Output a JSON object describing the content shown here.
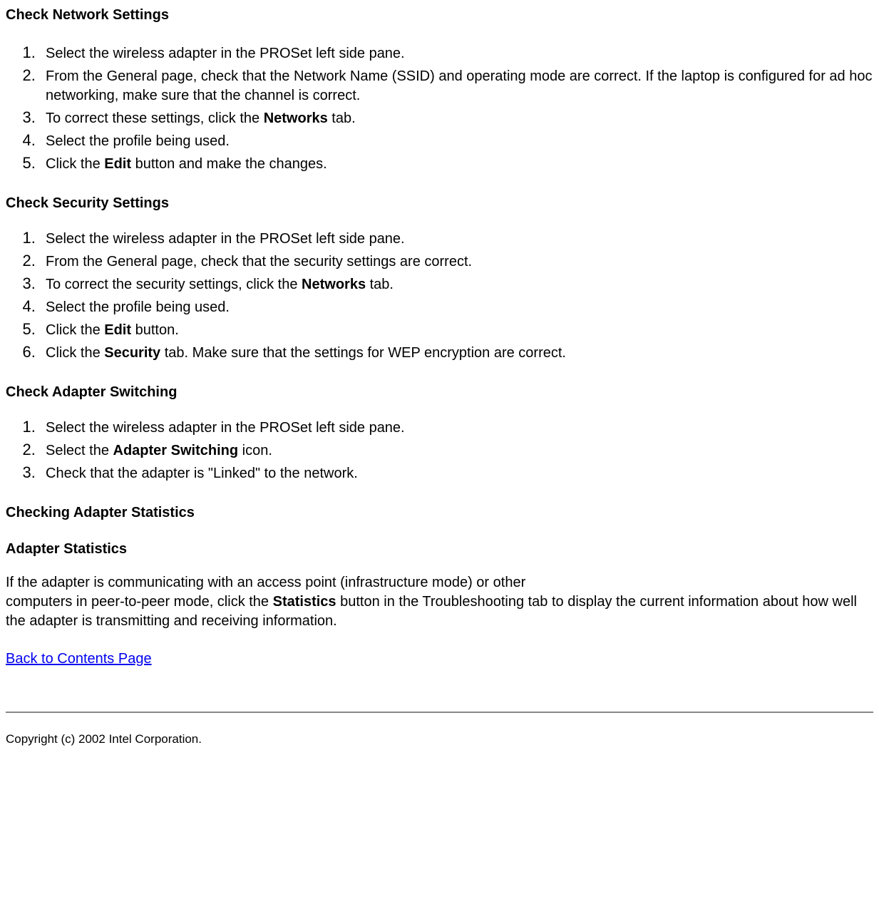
{
  "section1": {
    "heading": "Check Network Settings",
    "items": {
      "i1": "Select the wireless adapter in the PROSet left side pane.",
      "i2": "From the General page, check that the Network Name (SSID) and operating mode are correct. If the laptop is configured for ad hoc networking, make sure that the channel is correct.",
      "i3a": "To correct these settings, click the ",
      "i3b": "Networks",
      "i3c": " tab.",
      "i4": "Select the profile being used.",
      "i5a": "Click the ",
      "i5b": "Edit",
      "i5c": " button and make the changes."
    }
  },
  "section2": {
    "heading": "Check Security Settings",
    "items": {
      "i1": "Select the wireless adapter in the PROSet left side pane.",
      "i2": "From the General page, check that the security settings are correct.",
      "i3a": "To correct the security settings, click the ",
      "i3b": "Networks",
      "i3c": " tab.",
      "i4": "Select the profile being used.",
      "i5a": "Click the ",
      "i5b": "Edit",
      "i5c": " button.",
      "i6a": "Click the ",
      "i6b": "Security",
      "i6c": " tab. Make sure that the settings for WEP encryption are correct."
    }
  },
  "section3": {
    "heading": "Check Adapter Switching",
    "items": {
      "i1": "Select the wireless adapter in the PROSet left side pane.",
      "i2a": "Select the ",
      "i2b": "Adapter Switching",
      "i2c": " icon.",
      "i3": "Check that the adapter is \"Linked\" to the network."
    }
  },
  "section4": {
    "heading": "Checking Adapter Statistics",
    "subheading": "Adapter Statistics",
    "p1a": "If the adapter is communicating with an access point (infrastructure mode) or other",
    "p1b": "computers in peer-to-peer mode, click the ",
    "p1c": "Statistics",
    "p1d": " button in the Troubleshooting tab to display the current information about how well the adapter is transmitting and receiving information."
  },
  "link": "Back to Contents Page",
  "copyright": "Copyright (c) 2002 Intel Corporation."
}
